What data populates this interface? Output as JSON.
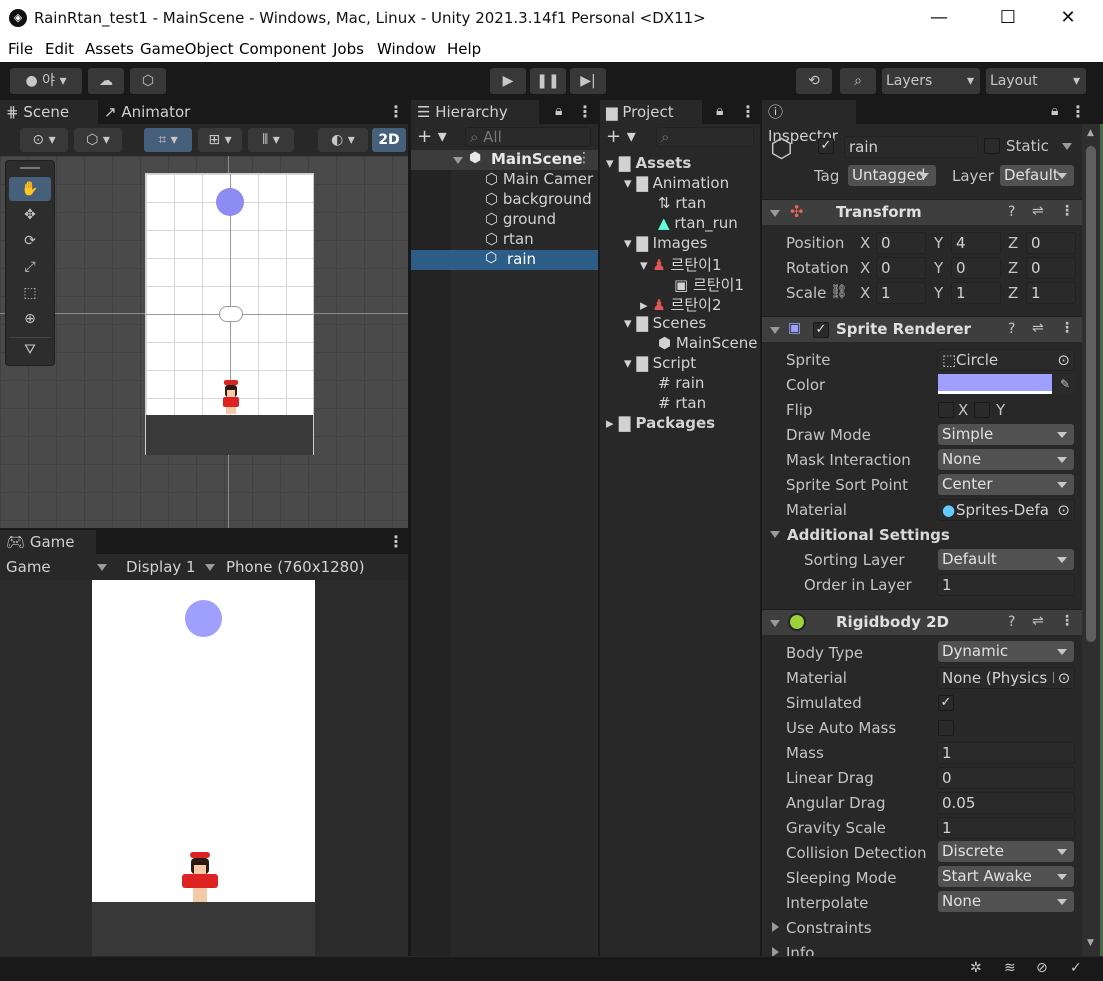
{
  "window": {
    "title": "RainRtan_test1 - MainScene - Windows, Mac, Linux - Unity 2021.3.14f1 Personal <DX11>",
    "minimize": "—",
    "maximize": "☐",
    "close": "✕"
  },
  "menu": [
    "File",
    "Edit",
    "Assets",
    "GameObject",
    "Component",
    "Jobs",
    "Window",
    "Help"
  ],
  "toolbar": {
    "account": "야",
    "layers": "Layers",
    "layout": "Layout"
  },
  "scene": {
    "tab_scene": "Scene",
    "tab_animator": "Animator",
    "mode_2d": "2D"
  },
  "game": {
    "tab": "Game",
    "view": "Game",
    "display": "Display 1",
    "resolution": "Phone (760x1280)"
  },
  "hierarchy": {
    "tab": "Hierarchy",
    "search": "All",
    "root": "MainScene",
    "items": [
      "Main Camer",
      "background",
      "ground",
      "rtan",
      "rain"
    ],
    "selected": "rain"
  },
  "project": {
    "tab": "Project",
    "tree": [
      {
        "label": "Assets",
        "depth": 0,
        "bold": true
      },
      {
        "label": "Animation",
        "depth": 1
      },
      {
        "label": "rtan",
        "depth": 2
      },
      {
        "label": "rtan_run",
        "depth": 2
      },
      {
        "label": "Images",
        "depth": 1
      },
      {
        "label": "르탄이1",
        "depth": 2
      },
      {
        "label": "르탄이1",
        "depth": 3
      },
      {
        "label": "르탄이2",
        "depth": 2
      },
      {
        "label": "Scenes",
        "depth": 1
      },
      {
        "label": "MainScene",
        "depth": 2
      },
      {
        "label": "Script",
        "depth": 1
      },
      {
        "label": "rain",
        "depth": 2
      },
      {
        "label": "rtan",
        "depth": 2
      },
      {
        "label": "Packages",
        "depth": 0,
        "bold": true
      }
    ]
  },
  "inspector": {
    "tab": "Inspector",
    "object_name": "rain",
    "static_label": "Static",
    "tag_label": "Tag",
    "tag_value": "Untagged",
    "layer_label": "Layer",
    "layer_value": "Default",
    "transform": {
      "title": "Transform",
      "position_label": "Position",
      "rotation_label": "Rotation",
      "scale_label": "Scale",
      "position": [
        "0",
        "4",
        "0"
      ],
      "rotation": [
        "0",
        "0",
        "0"
      ],
      "scale": [
        "1",
        "1",
        "1"
      ]
    },
    "sprite_renderer": {
      "title": "Sprite Renderer",
      "sprite_label": "Sprite",
      "sprite": "Circle",
      "color_label": "Color",
      "color": "#9f9fff",
      "flip_label": "Flip",
      "draw_mode_label": "Draw Mode",
      "draw_mode": "Simple",
      "mask_label": "Mask Interaction",
      "mask": "None",
      "sort_point_label": "Sprite Sort Point",
      "sort_point": "Center",
      "material_label": "Material",
      "material": "Sprites-Defa",
      "additional": "Additional Settings",
      "sorting_layer_label": "Sorting Layer",
      "sorting_layer": "Default",
      "order_label": "Order in Layer",
      "order": "1"
    },
    "rigidbody": {
      "title": "Rigidbody 2D",
      "body_type_label": "Body Type",
      "body_type": "Dynamic",
      "material_label": "Material",
      "material": "None (Physics M",
      "simulated_label": "Simulated",
      "auto_mass_label": "Use Auto Mass",
      "mass_label": "Mass",
      "mass": "1",
      "linear_label": "Linear Drag",
      "linear": "0",
      "angular_label": "Angular Drag",
      "angular": "0.05",
      "gravity_label": "Gravity Scale",
      "gravity": "1",
      "collision_label": "Collision Detection",
      "collision": "Discrete",
      "sleeping_label": "Sleeping Mode",
      "sleeping": "Start Awake",
      "interp_label": "Interpolate",
      "interp": "None",
      "constraints": "Constraints",
      "info": "Info"
    },
    "axes": {
      "x": "X",
      "y": "Y",
      "z": "Z"
    }
  }
}
